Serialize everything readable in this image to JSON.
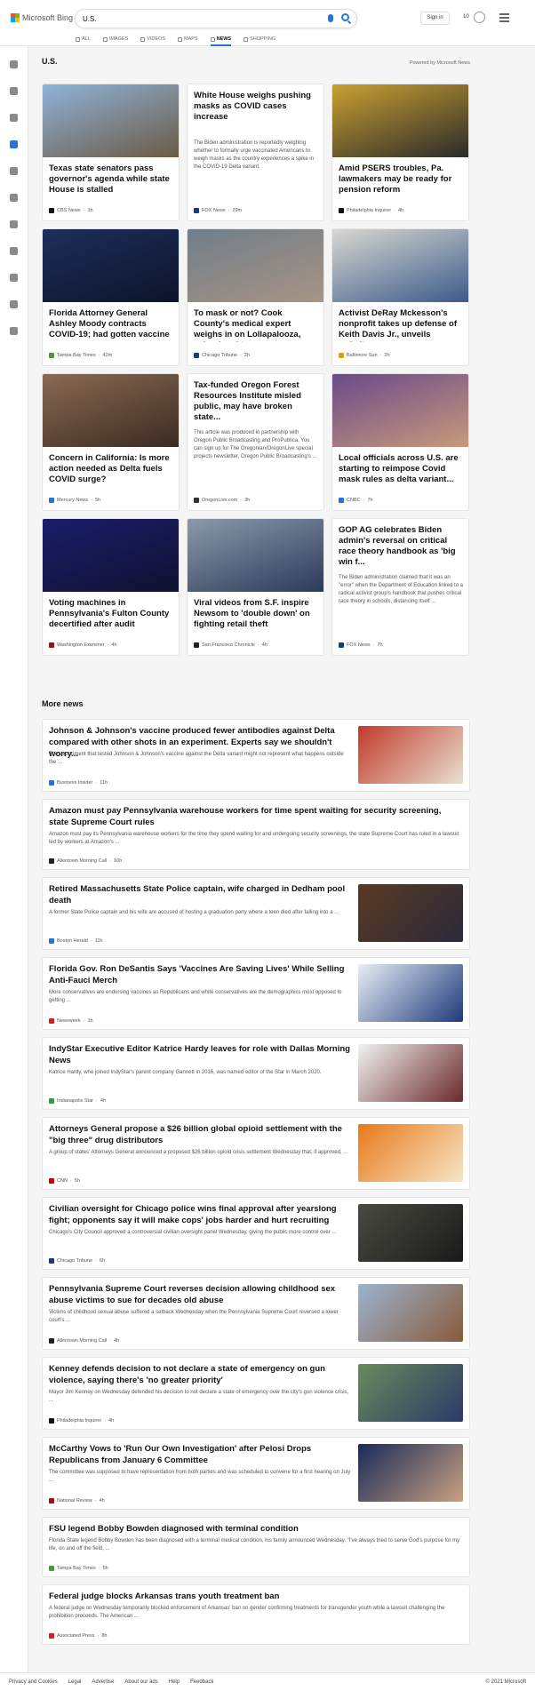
{
  "header": {
    "brand": "Microsoft Bing",
    "query": "U.S.",
    "signin_label": "Sign in",
    "points": "10",
    "tabs": [
      {
        "label": "ALL",
        "active": false
      },
      {
        "label": "IMAGES",
        "active": false
      },
      {
        "label": "VIDEOS",
        "active": false
      },
      {
        "label": "MAPS",
        "active": false
      },
      {
        "label": "NEWS",
        "active": true
      },
      {
        "label": "SHOPPING",
        "active": false
      }
    ],
    "accent": "#2b72d7"
  },
  "section": {
    "title": "U.S.",
    "powered_by": "Powered by Microsoft News"
  },
  "top_stories": [
    {
      "title": "Texas state senators pass governor's agenda while state House is stalled",
      "snippet": "",
      "source": "CBS News",
      "age": "1h",
      "has_image": true,
      "image_colors": [
        "#8fb3d9",
        "#6b5a44"
      ],
      "source_color": "#111111"
    },
    {
      "title": "White House weighs pushing masks as COVID cases increase",
      "snippet": "The Biden administration is reportedly weighing whether to formally urge vaccinated Americans to weigh masks as the country experiences a spike in the COVID-19 Delta variant.",
      "source": "FOX News",
      "age": "29m",
      "has_image": false,
      "source_color": "#1b3a7a"
    },
    {
      "title": "Amid PSERS troubles, Pa. lawmakers may be ready for pension reform",
      "snippet": "",
      "source": "Philadelphia Inquirer",
      "age": "4h",
      "has_image": true,
      "image_colors": [
        "#c9a032",
        "#2a2a2a"
      ],
      "source_color": "#111111"
    },
    {
      "title": "Florida Attorney General Ashley Moody contracts COVID-19; had gotten vaccine",
      "snippet": "",
      "source": "Tampa Bay Times",
      "age": "42m",
      "has_image": true,
      "image_colors": [
        "#1e2e5c",
        "#0d1428"
      ],
      "source_color": "#4a9a3a"
    },
    {
      "title": "To mask or not? Cook County's medical expert weighs in on Lollapalooza, school and trav...",
      "snippet": "",
      "source": "Chicago Tribune",
      "age": "2h",
      "has_image": true,
      "image_colors": [
        "#6f7e8a",
        "#a89484"
      ],
      "source_color": "#1b3a7a"
    },
    {
      "title": "Activist DeRay Mckesson's nonprofit takes up defense of Keith Davis Jr., unveils websit...",
      "snippet": "",
      "source": "Baltimore Sun",
      "age": "2h",
      "has_image": true,
      "image_colors": [
        "#d8d8d0",
        "#3b5a8a"
      ],
      "source_color": "#e0a010"
    },
    {
      "title": "Concern in California: Is more action needed as Delta fuels COVID surge?",
      "snippet": "",
      "source": "Mercury News",
      "age": "5h",
      "has_image": true,
      "image_colors": [
        "#8a6a52",
        "#3a2a22"
      ],
      "source_color": "#2b72d7"
    },
    {
      "title": "Tax-funded Oregon Forest Resources Institute misled public, may have broken state...",
      "snippet": "This article was produced in partnership with Oregon Public Broadcasting and ProPublica. You can sign up for The Oregonian/OregonLive special projects newsletter, Oregon Public Broadcasting's ...",
      "source": "OregonLive.com",
      "age": "3h",
      "has_image": false,
      "source_color": "#333333"
    },
    {
      "title": "Local officials across U.S. are starting to reimpose Covid mask rules as delta variant...",
      "snippet": "",
      "source": "CNBC",
      "age": "7h",
      "has_image": true,
      "image_colors": [
        "#6a4a8a",
        "#c89a7a"
      ],
      "source_color": "#2b72d7"
    },
    {
      "title": "Voting machines in Pennsylvania's Fulton County decertified after audit",
      "snippet": "",
      "source": "Washington Examiner",
      "age": "4h",
      "has_image": true,
      "image_colors": [
        "#1a1e6a",
        "#101030"
      ],
      "source_color": "#a01010"
    },
    {
      "title": "Viral videos from S.F. inspire Newsom to 'double down' on fighting retail theft",
      "snippet": "",
      "source": "San Francisco Chronicle",
      "age": "4h",
      "has_image": true,
      "image_colors": [
        "#8a9aaa",
        "#2a3a5a"
      ],
      "source_color": "#222222"
    },
    {
      "title": "GOP AG celebrates Biden admin's reversal on critical race theory handbook as 'big win f...",
      "snippet": "The Biden administration claimed that it was an \"error\" when the Department of Education linked to a radical activist group's handbook that pushes critical race theory in schools, distancing itself ...",
      "source": "FOX News",
      "age": "7h",
      "has_image": false,
      "source_color": "#1b3a7a"
    }
  ],
  "more_news": {
    "title": "More news",
    "items": [
      {
        "title": "Johnson & Johnson's vaccine produced fewer antibodies against Delta compared with other shots in an experiment. Experts say we shouldn't worry...",
        "snippet": "The experiment that tested Johnson & Johnson's vaccine against the Delta variant might not represent what happens outside the ...",
        "source": "Business Insider",
        "age": "11h",
        "has_image": true,
        "image_colors": [
          "#c23a2a",
          "#e8e0d0"
        ],
        "source_color": "#2b72d7"
      },
      {
        "title": "Amazon must pay Pennsylvania warehouse workers for time spent waiting for security screening, state Supreme Court rules",
        "snippet": "Amazon must pay its Pennsylvania warehouse workers for the time they spend waiting for and undergoing security screenings, the state Supreme Court has ruled in a lawsuit led by workers at Amazon's ...",
        "source": "Allentown Morning Call",
        "age": "10h",
        "has_image": false,
        "source_color": "#222222"
      },
      {
        "title": "Retired Massachusetts State Police captain, wife charged in Dedham pool death",
        "snippet": "A former State Police captain and his wife are accused of hosting a graduation party where a teen died after falling into a ...",
        "source": "Boston Herald",
        "age": "11h",
        "has_image": true,
        "image_colors": [
          "#5a3a22",
          "#2a2a3a"
        ],
        "source_color": "#2b72d7"
      },
      {
        "title": "Florida Gov. Ron DeSantis Says 'Vaccines Are Saving Lives' While Selling Anti-Fauci Merch",
        "snippet": "More conservatives are endorsing vaccines as Republicans and white conservatives are the demographics most opposed to getting ...",
        "source": "Newsweek",
        "age": "1h",
        "has_image": true,
        "image_colors": [
          "#e8eef6",
          "#1e3a7a"
        ],
        "source_color": "#d02020"
      },
      {
        "title": "IndyStar Executive Editor Katrice Hardy leaves for role with Dallas Morning News",
        "snippet": "Katrice Hardy, who joined IndyStar's parent company Gannett in 2016, was named editor of the Star in March 2020.",
        "source": "Indianapolis Star",
        "age": "4h",
        "has_image": true,
        "image_colors": [
          "#f2f2f2",
          "#6a2a2a"
        ],
        "source_color": "#3a9a3a"
      },
      {
        "title": "Attorneys General propose a $26 billion global opioid settlement with the \"big three\" drug distributors",
        "snippet": "A group of states' Attorneys General announced a proposed $26 billion opioid crisis settlement Wednesday that, if approved, ...",
        "source": "CNN",
        "age": "5h",
        "has_image": true,
        "image_colors": [
          "#e87a1a",
          "#f6e6c6"
        ],
        "source_color": "#cc0000"
      },
      {
        "title": "Civilian oversight for Chicago police wins final approval after yearslong fight; opponents say it will make cops' jobs harder and hurt recruiting",
        "snippet": "Chicago's City Council approved a controversial civilian oversight panel Wednesday, giving the public more control over ...",
        "source": "Chicago Tribune",
        "age": "6h",
        "has_image": true,
        "image_colors": [
          "#4a4a42",
          "#1a1a1a"
        ],
        "source_color": "#1b3a7a"
      },
      {
        "title": "Pennsylvania Supreme Court reverses decision allowing childhood sex abuse victims to sue for decades old abuse",
        "snippet": "Victims of childhood sexual abuse suffered a setback Wednesday when the Pennsylvania Supreme Court reversed a lower court's ...",
        "source": "Allentown Morning Call",
        "age": "4h",
        "has_image": true,
        "image_colors": [
          "#9ab4d0",
          "#8a5a3a"
        ],
        "source_color": "#222222"
      },
      {
        "title": "Kenney defends decision to not declare a state of emergency on gun violence, saying there's 'no greater priority'",
        "snippet": "Mayor Jim Kenney on Wednesday defended his decision to not declare a state of emergency over the city's gun violence crisis, ...",
        "source": "Philadelphia Inquirer",
        "age": "4h",
        "has_image": true,
        "image_colors": [
          "#6a8a5a",
          "#2a3a6a"
        ],
        "source_color": "#111111"
      },
      {
        "title": "McCarthy Vows to 'Run Our Own Investigation' after Pelosi Drops Republicans from January 6 Committee",
        "snippet": "The committee was supposed to have representation from both parties and was scheduled to convene for a first hearing on July ...",
        "source": "National Review",
        "age": "4h",
        "has_image": true,
        "image_colors": [
          "#1a2a5a",
          "#c8a080"
        ],
        "source_color": "#a01010"
      },
      {
        "title": "FSU legend Bobby Bowden diagnosed with terminal condition",
        "snippet": "Florida State legend Bobby Bowden has been diagnosed with a terminal medical condition, his family announced Wednesday. \"I've always tried to serve God's purpose for my life, on and off the field, ...",
        "source": "Tampa Bay Times",
        "age": "5h",
        "has_image": false,
        "source_color": "#4a9a3a"
      },
      {
        "title": "Federal judge blocks Arkansas trans youth treatment ban",
        "snippet": "A federal judge on Wednesday temporarily blocked enforcement of Arkansas' ban on gender confirming treatments for transgender youth while a lawsuit challenging the prohibition proceeds. The American ...",
        "source": "Associated Press",
        "age": "8h",
        "has_image": false,
        "source_color": "#d02020"
      }
    ]
  },
  "rail_icons": [
    "expand-icon",
    "home-icon",
    "sports-icon",
    "flag-icon",
    "location-icon",
    "world-icon",
    "science-icon",
    "rocket-icon",
    "entertainment-icon",
    "money-icon",
    "card-icon"
  ],
  "footer": {
    "links": [
      "Privacy and Cookies",
      "Legal",
      "Advertise",
      "About our ads",
      "Help",
      "Feedback"
    ],
    "copyright": "© 2021 Microsoft"
  }
}
